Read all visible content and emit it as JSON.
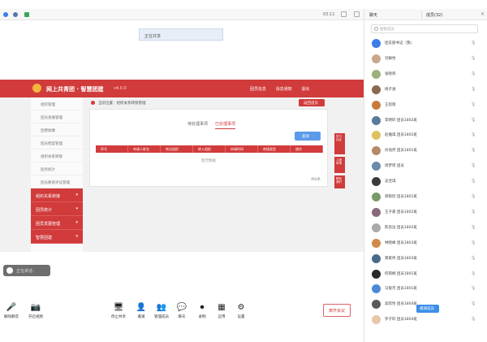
{
  "top": {
    "time": "03:11",
    "icons": [
      "camera-icon",
      "shield-icon",
      "signal-icon"
    ]
  },
  "share_banner": "正在共享",
  "webpage": {
    "title": "网上共青团 · 智慧团建",
    "version": "v4.0.0",
    "nav": [
      "团员信息",
      "消息通知",
      "退出"
    ],
    "sidebar_items": [
      "组织管理",
      "团员发展管理",
      "团费收缴",
      "团员档案管理",
      "组织关系转接",
      "团务统计",
      "团员教育评议管理"
    ],
    "sidebar_sections": [
      "组织关系转接",
      "团员统计",
      "团员发展管理",
      "智慧团建"
    ],
    "breadcrumb": "当前位置：组织关系转接管理",
    "crumb_button": "返回首页",
    "tabs": [
      "待处理事项",
      "已处理事项"
    ],
    "search_button": "查询",
    "columns": [
      "序号",
      "申请人姓名",
      "转出组织",
      "转入组织",
      "申请时间",
      "转接类型",
      "操作"
    ],
    "empty": "暂无数据",
    "total": "共0条",
    "float_buttons": [
      "学习社区",
      "入团申请",
      "联系我们"
    ]
  },
  "mini_bubble": "正在讲话：",
  "toolbar": [
    {
      "label": "解除静音",
      "glyph": "🎤"
    },
    {
      "label": "开启视频",
      "glyph": "📷"
    },
    {
      "label": "停止共享",
      "glyph": "🖥"
    },
    {
      "label": "邀请",
      "glyph": "👤"
    },
    {
      "label": "管理成员",
      "glyph": "👥"
    },
    {
      "label": "聊天",
      "glyph": "💬"
    },
    {
      "label": "录制",
      "glyph": "⏺"
    },
    {
      "label": "应用",
      "glyph": "▦"
    },
    {
      "label": "设置",
      "glyph": "⚙"
    }
  ],
  "leave_button": "离开会议",
  "panel": {
    "tab_chat": "聊天",
    "tab_members": "成员(32)",
    "search_placeholder": "搜索成员",
    "members": [
      {
        "name": "团支部书记（我）",
        "color": "#3d7de8"
      },
      {
        "name": "刘静怡",
        "color": "#c9a78c"
      },
      {
        "name": "张晓燕",
        "color": "#9cb07a"
      },
      {
        "name": "杨子涵",
        "color": "#8a6a4e"
      },
      {
        "name": "王思雨",
        "color": "#c77b3b"
      },
      {
        "name": "李明轩 团员1802班",
        "color": "#5a7a9a"
      },
      {
        "name": "赵雅琪 团员1802班",
        "color": "#e0c060"
      },
      {
        "name": "孙浩然 团员1801班",
        "color": "#b58a6a"
      },
      {
        "name": "周梦瑶 团员",
        "color": "#6a8aa8"
      },
      {
        "name": "吴佳琪",
        "color": "#3a3a3a"
      },
      {
        "name": "郑雨欣 团员1801班",
        "color": "#7a9a6a"
      },
      {
        "name": "王子豪 团员1802班",
        "color": "#8a6a7a"
      },
      {
        "name": "陈思远 团员1802班",
        "color": "#aaaaaa"
      },
      {
        "name": "林晓峰 团员1803班",
        "color": "#d08a4a"
      },
      {
        "name": "黄家伟 团员1803班",
        "color": "#4a6a8a"
      },
      {
        "name": "何雨桐 团员1801班",
        "color": "#2a2a2a"
      },
      {
        "name": "马俊杰 团员1801班",
        "color": "#4a8ad8"
      },
      {
        "name": "高欣怡 团员1804班",
        "color": "#5a5a5a"
      },
      {
        "name": "罗子轩 团员1804班",
        "color": "#e8c8a8"
      }
    ],
    "invite_button": "邀请成员"
  }
}
